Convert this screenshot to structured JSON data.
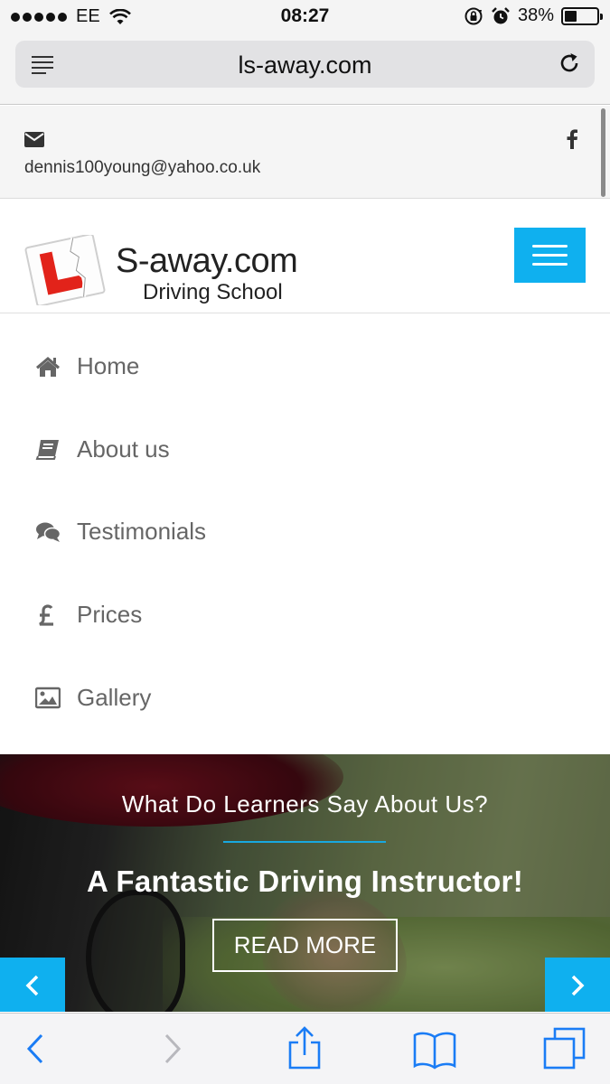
{
  "status_bar": {
    "carrier": "EE",
    "time": "08:27",
    "battery_percent": "38%",
    "battery_level": 0.38,
    "icons": [
      "signal-dots",
      "wifi-icon",
      "rotation-lock-icon",
      "alarm-icon",
      "battery-icon"
    ]
  },
  "browser": {
    "url": "ls-away.com",
    "icons": [
      "reader-view-icon",
      "reload-icon"
    ]
  },
  "contact": {
    "email": "dennis100young@yahoo.co.uk",
    "icons": [
      "envelope-icon",
      "facebook-icon"
    ]
  },
  "header": {
    "logo_title": "S-away.com",
    "logo_subtitle": "Driving School",
    "logo_plate_letter": "L",
    "menu_icon": "hamburger-icon",
    "accent_color": "#0fb0ef"
  },
  "nav": {
    "items": [
      {
        "label": "Home",
        "icon": "home-icon"
      },
      {
        "label": "About us",
        "icon": "book-icon"
      },
      {
        "label": "Testimonials",
        "icon": "comments-icon"
      },
      {
        "label": "Prices",
        "icon": "pound-icon"
      },
      {
        "label": "Gallery",
        "icon": "image-icon"
      }
    ]
  },
  "hero": {
    "kicker": "What Do Learners Say About Us?",
    "title": "A Fantastic Driving Instructor!",
    "button_label": "READ MORE",
    "prev_icon": "chevron-left-icon",
    "next_icon": "chevron-right-icon"
  },
  "toolbar": {
    "icons": [
      "back-icon",
      "forward-icon",
      "share-icon",
      "bookmarks-icon",
      "tabs-icon"
    ],
    "tint_color": "#1a7cf5"
  }
}
